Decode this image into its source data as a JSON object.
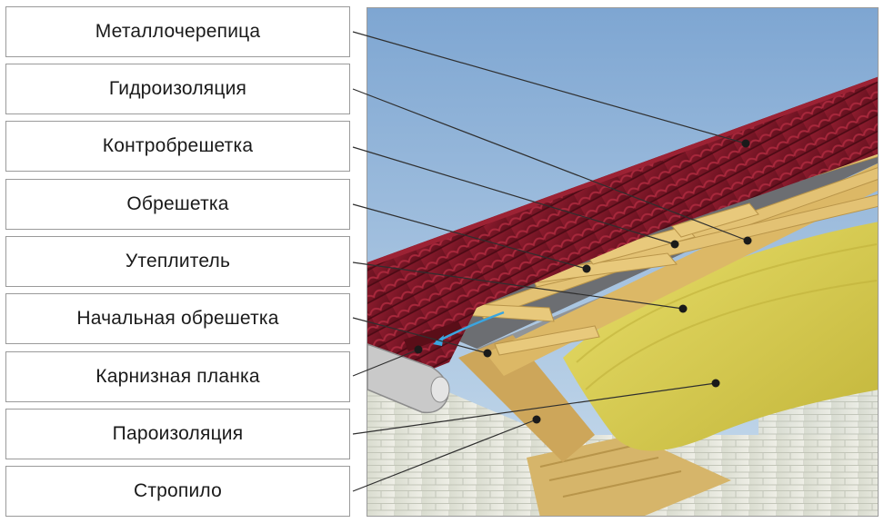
{
  "labels": [
    "Металлочерепица",
    "Гидроизоляция",
    "Контробрешетка",
    "Обрешетка",
    "Утеплитель",
    "Начальная обрешетка",
    "Карнизная планка",
    "Пароизоляция",
    "Стропило"
  ],
  "colors": {
    "sky": "#8fb3d8",
    "tile": "#7a1424",
    "timber": "#e0c070",
    "insulation": "#d8cd4a",
    "wall": "#e6e6dc",
    "gutter": "#c8c8c8",
    "leader": "#3a3a3a"
  }
}
